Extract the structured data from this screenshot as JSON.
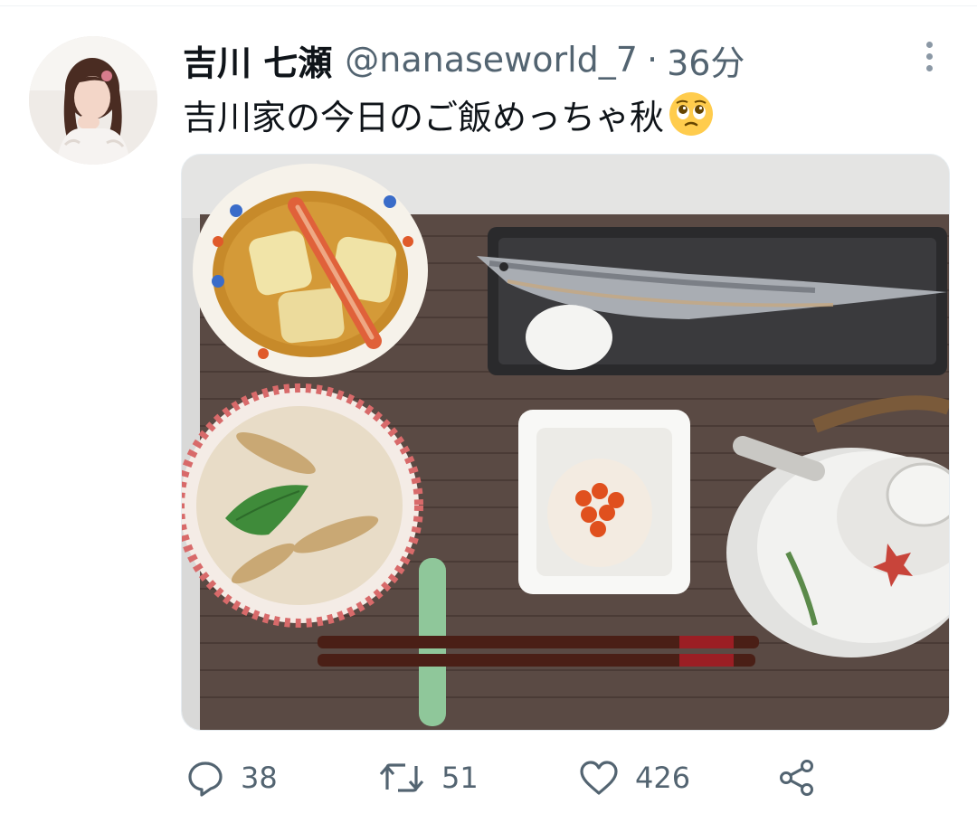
{
  "tweet": {
    "display_name": "吉川 七瀬",
    "handle": "@nanaseworld_7",
    "separator": "·",
    "time": "36分",
    "text": "吉川家の今日のご飯めっちゃ秋",
    "emoji": "face-with-pleading-eyes",
    "media_alt": "Autumn Japanese meal: grilled saury, winter melon with crab, takikomi rice, grated daikon with salmon roe, teapot"
  },
  "actions": {
    "reply_count": "38",
    "retweet_count": "51",
    "like_count": "426"
  },
  "colors": {
    "text_primary": "#0f1419",
    "text_secondary": "#536471",
    "icon": "#536471"
  }
}
